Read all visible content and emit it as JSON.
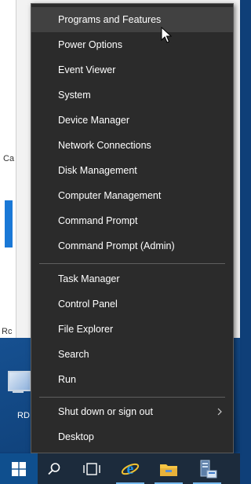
{
  "menu": {
    "items": [
      {
        "label": "Programs and Features",
        "hovered": true
      },
      {
        "label": "Power Options"
      },
      {
        "label": "Event Viewer"
      },
      {
        "label": "System"
      },
      {
        "label": "Device Manager"
      },
      {
        "label": "Network Connections"
      },
      {
        "label": "Disk Management"
      },
      {
        "label": "Computer Management"
      },
      {
        "label": "Command Prompt"
      },
      {
        "label": "Command Prompt (Admin)"
      },
      {
        "label": "Task Manager"
      },
      {
        "label": "Control Panel"
      },
      {
        "label": "File Explorer"
      },
      {
        "label": "Search"
      },
      {
        "label": "Run"
      },
      {
        "label": "Shut down or sign out",
        "has_submenu": true
      },
      {
        "label": "Desktop"
      }
    ]
  },
  "desktop": {
    "caption_top": "Ca",
    "caption_bottom": "Rc",
    "rd_icon_label": "RD"
  },
  "taskbar": {
    "icons": [
      "windows-logo-icon",
      "search-icon",
      "task-view-icon",
      "internet-explorer-icon",
      "file-explorer-icon",
      "server-manager-icon"
    ]
  },
  "colors": {
    "menu_bg": "#2b2b2b",
    "menu_hover": "#414141",
    "menu_text": "#ffffff",
    "taskbar_bg": "#1c2b3c",
    "accent": "#0f4f8e"
  }
}
